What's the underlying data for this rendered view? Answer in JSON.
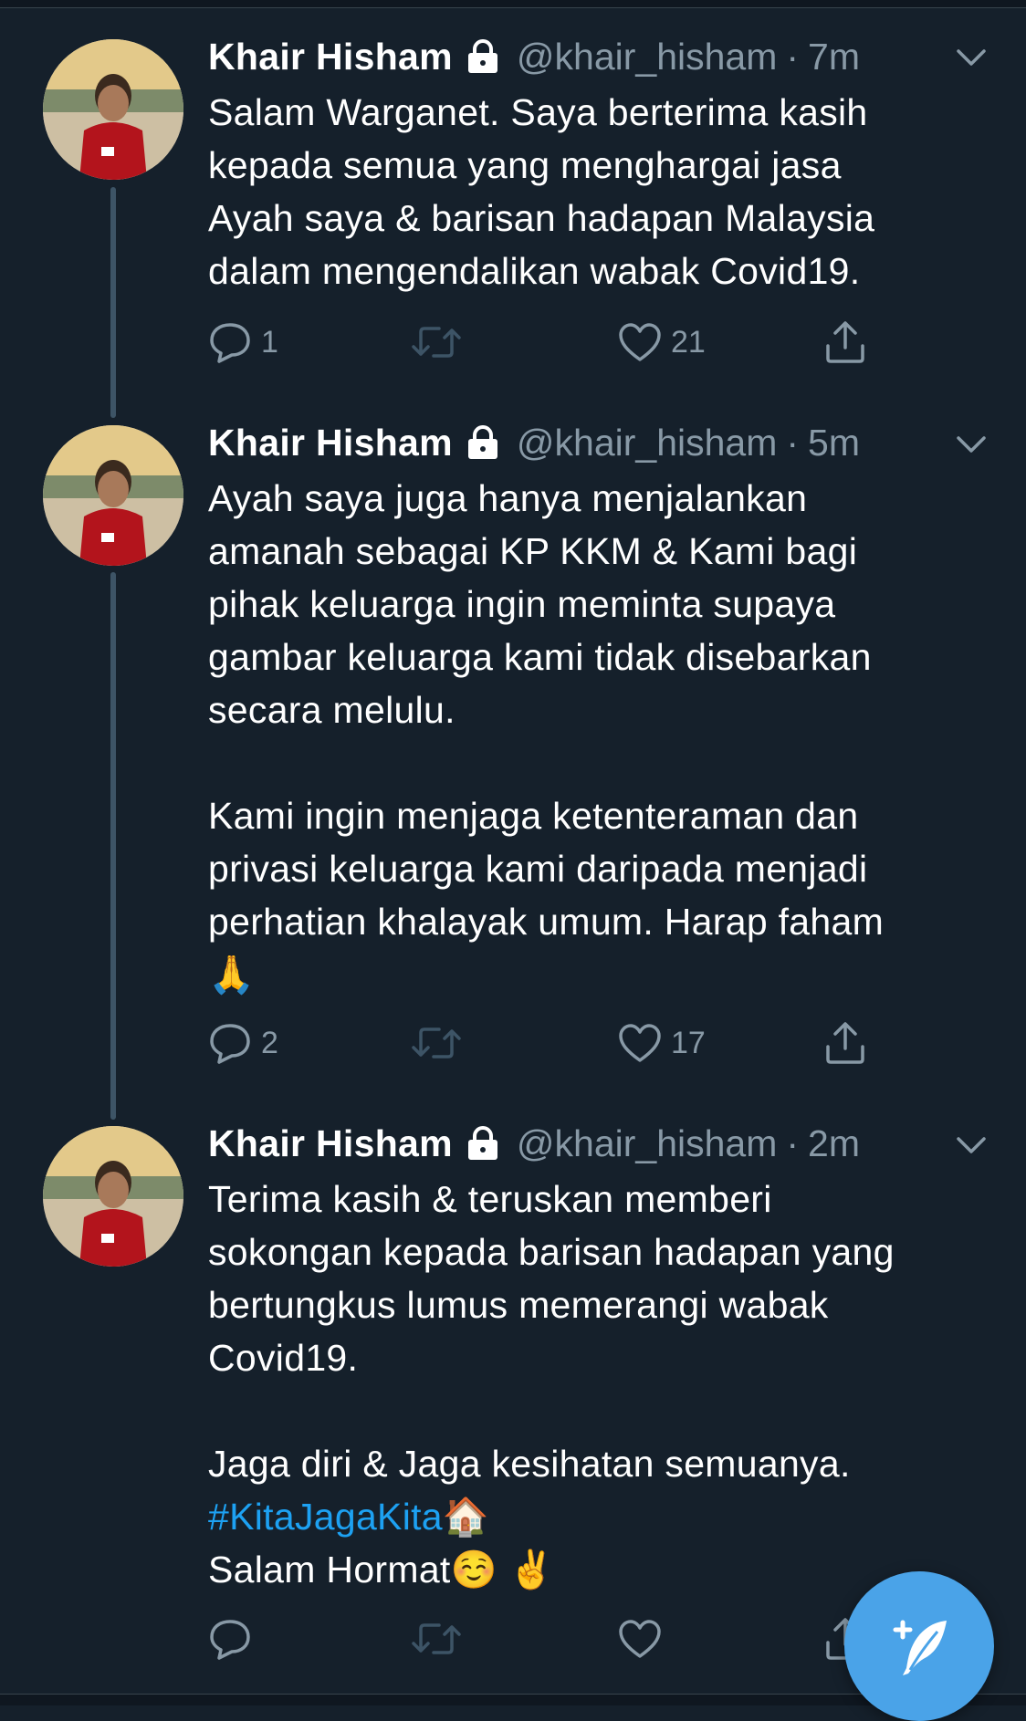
{
  "colors": {
    "background": "#15202b",
    "accent": "#1da1f2",
    "muted": "#8899a6",
    "fab": "#4aa3e8"
  },
  "tweets": [
    {
      "name": "Khair Hisham",
      "handle": "@khair_hisham",
      "dot": "·",
      "time": "7m",
      "text": "Salam Warganet. Saya berterima kasih\nkepada semua yang menghargai jasa\nAyah saya & barisan hadapan Malaysia\ndalam mengendalikan wabak Covid19.",
      "reply_count": "1",
      "retweet_count": "",
      "like_count": "21"
    },
    {
      "name": "Khair Hisham",
      "handle": "@khair_hisham",
      "dot": "·",
      "time": "5m",
      "text": "Ayah saya juga hanya menjalankan\namanah sebagai KP KKM & Kami bagi\npihak keluarga ingin meminta supaya\ngambar keluarga kami tidak disebarkan\nsecara melulu.\n\nKami ingin menjaga ketenteraman dan\nprivasi keluarga kami daripada menjadi\nperhatian khalayak umum. Harap faham\n🙏",
      "reply_count": "2",
      "retweet_count": "",
      "like_count": "17"
    },
    {
      "name": "Khair Hisham",
      "handle": "@khair_hisham",
      "dot": "·",
      "time": "2m",
      "text_main": "Terima kasih & teruskan memberi\nsokongan kepada barisan hadapan yang\nbertungkus lumus memerangi wabak\nCovid19.\n\nJaga diri & Jaga kesihatan semuanya.",
      "hashtag": "#KitaJagaKita",
      "hashtag_emoji": "🏠",
      "closing": "Salam Hormat☺️ ✌️",
      "reply_count": "",
      "retweet_count": "",
      "like_count": ""
    }
  ],
  "icons": {
    "lock": "lock-icon",
    "caret": "chevron-down-icon",
    "reply": "reply-icon",
    "retweet": "retweet-icon",
    "like": "heart-icon",
    "share": "share-icon",
    "compose": "compose-tweet-icon"
  }
}
